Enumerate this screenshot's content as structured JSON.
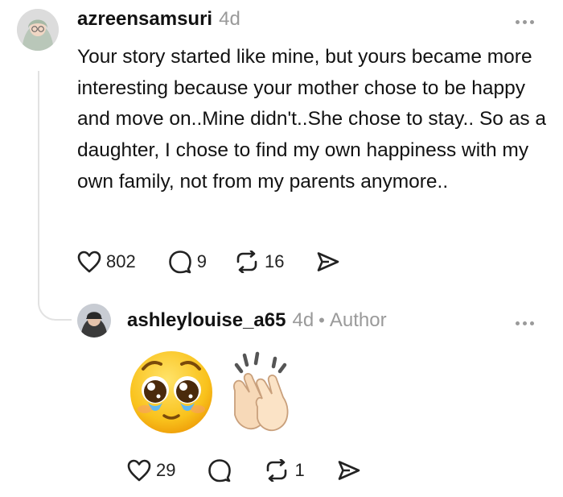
{
  "comment": {
    "username": "azreensamsuri",
    "time": "4d",
    "text": "Your story started like mine, but yours became more interesting because your mother chose to be happy and move on..Mine didn't..She chose to stay.. So as a daughter, I chose to find my own happiness with my own family, not from my parents anymore..",
    "likes": "802",
    "replies": "9",
    "reposts": "16"
  },
  "reply": {
    "username": "ashleylouise_a65",
    "time": "4d",
    "separator": "•",
    "badge": "Author",
    "emojis": [
      "pleading-face-emoji",
      "clapping-hands-emoji"
    ],
    "likes": "29",
    "reposts": "1"
  },
  "icons": {
    "like": "heart-icon",
    "reply": "comment-bubble-icon",
    "repost": "repost-icon",
    "share": "send-icon",
    "more": "more-options-icon"
  }
}
